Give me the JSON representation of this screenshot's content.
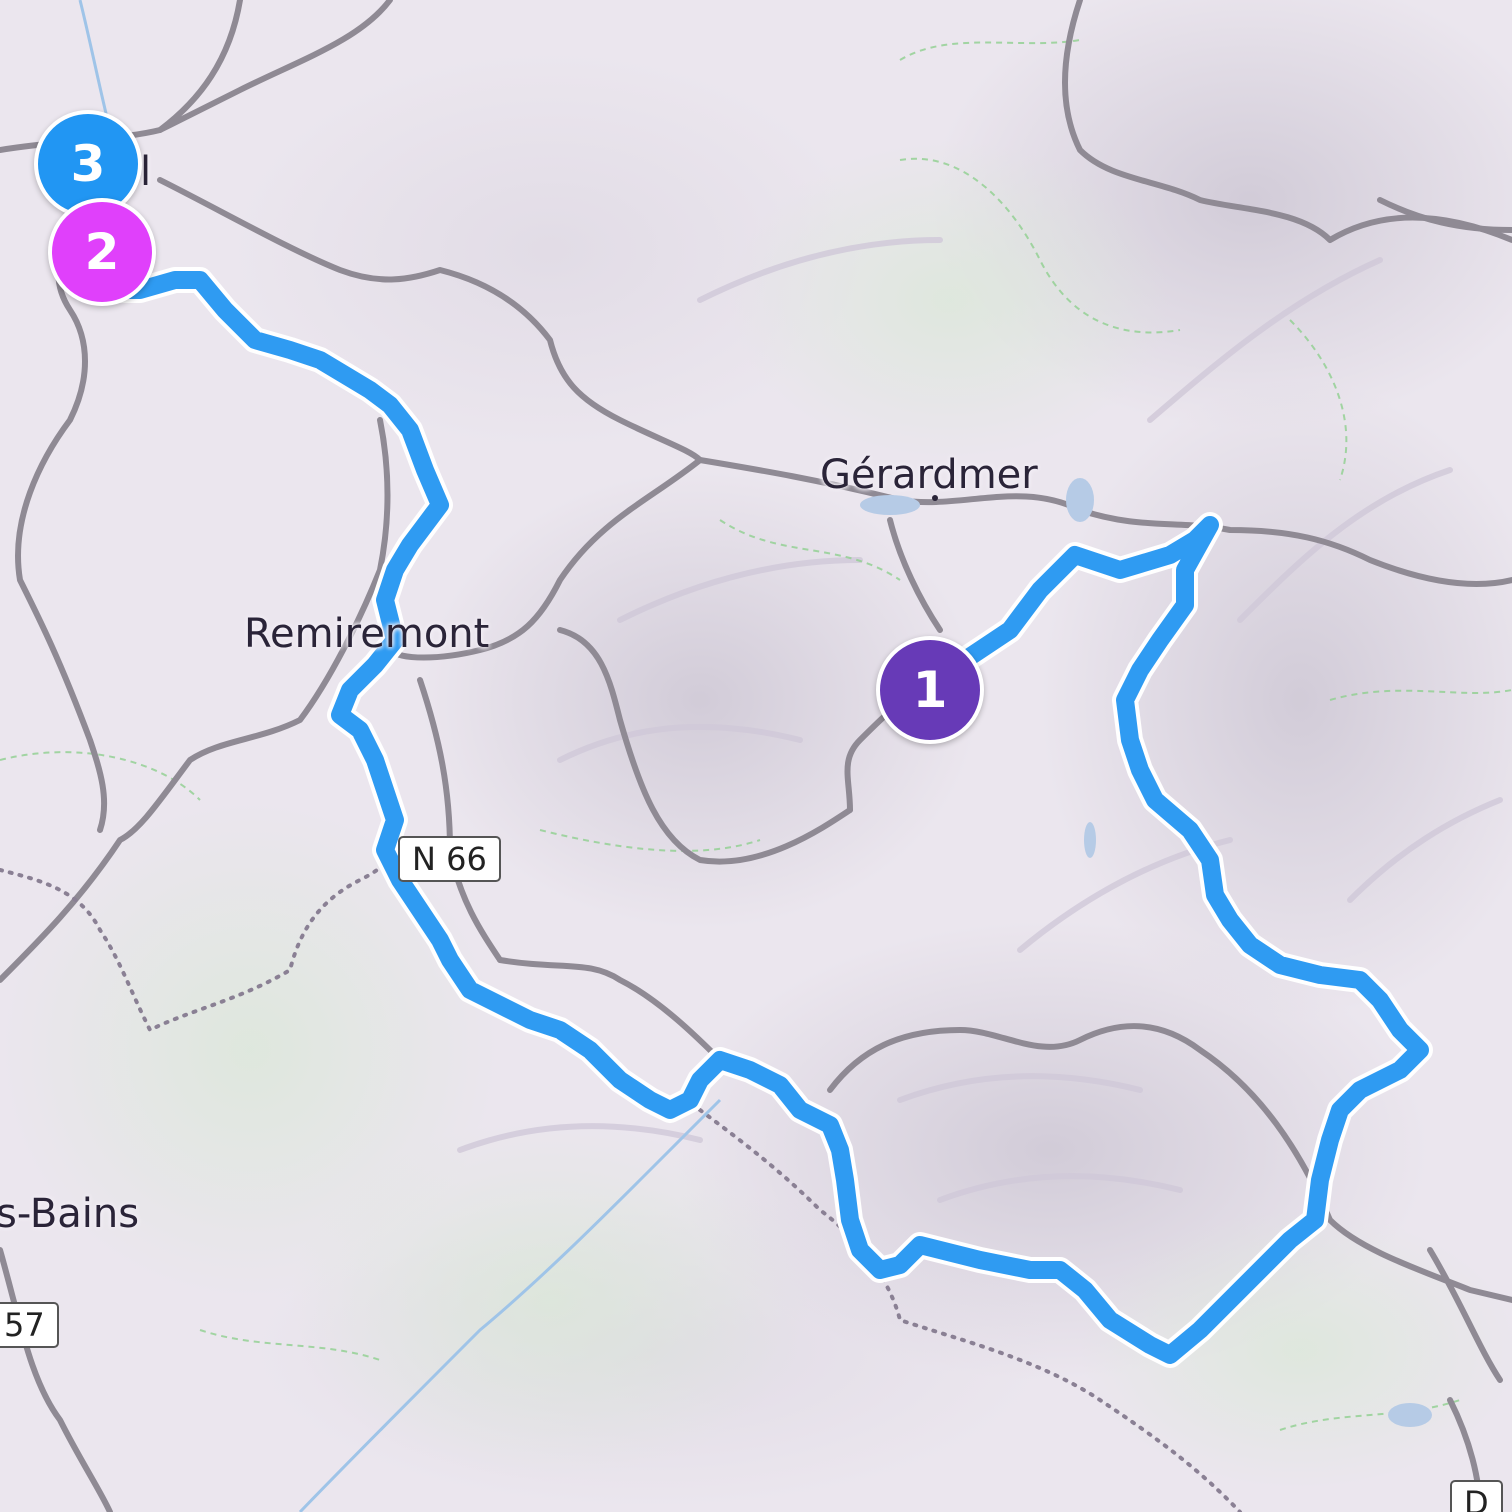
{
  "map": {
    "places": {
      "gerardmer": "Gérardmer",
      "remiremont": "Remiremont",
      "bains": "s-Bains",
      "epinal_partial": "l"
    },
    "road_shields": {
      "n66": "N 66",
      "d57": "57",
      "d_bottom_right": "D"
    },
    "markers": [
      {
        "label": "1",
        "color": "#673ab7"
      },
      {
        "label": "2",
        "color": "#e040fb"
      },
      {
        "label": "3",
        "color": "#2196f3"
      }
    ],
    "colors": {
      "route": "#2f9bf2",
      "route_outline": "#ffffff",
      "road": "#8f8a94",
      "forest_border": "#8fcf8f",
      "border": "#8a8094",
      "land": "#ebe6ee"
    }
  }
}
